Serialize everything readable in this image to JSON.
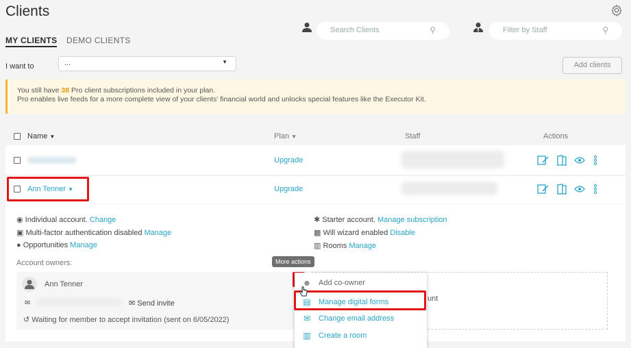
{
  "page": {
    "title": "Clients"
  },
  "tabs": [
    {
      "label": "MY CLIENTS"
    },
    {
      "label": "DEMO CLIENTS"
    }
  ],
  "search": {
    "placeholder": "Search Clients"
  },
  "staff_filter": {
    "placeholder": "Filter by Staff"
  },
  "i_want_to": {
    "label": "I want to",
    "value": "..."
  },
  "add_clients": {
    "label": "Add clients"
  },
  "banner": {
    "pre": "You still have ",
    "count": "38",
    "post": " Pro client subscriptions included in your plan.",
    "line2": "Pro enables live feeds for a more complete view of your clients' financial world and unlocks special features like the Executor Kit."
  },
  "table": {
    "headers": {
      "name": "Name",
      "plan": "Plan",
      "staff": "Staff",
      "actions": "Actions"
    },
    "rows": [
      {
        "name": "",
        "plan": "Upgrade"
      },
      {
        "name": "Ann Tenner",
        "plan": "Upgrade"
      }
    ]
  },
  "details": {
    "individual": "Individual account.",
    "individual_link": "Change",
    "mfa": "Multi-factor authentication disabled",
    "mfa_link": "Manage",
    "opportunities": "Opportunities",
    "opportunities_link": "Manage",
    "starter": "Starter account.",
    "starter_link": "Manage subscription",
    "wizard": "Will wizard enabled",
    "wizard_link": "Disable",
    "rooms": "Rooms",
    "rooms_link": "Manage",
    "owners_label": "Account owners:"
  },
  "owner": {
    "name": "Ann Tenner",
    "send_invite": "Send invite",
    "waiting": "Waiting for member to accept invitation (sent on 6/05/2022)"
  },
  "dash_text": "unt",
  "tooltip": "More actions",
  "menu": [
    {
      "label": "Add co-owner",
      "icon": "add-person-icon"
    },
    {
      "label": "Manage digital forms",
      "icon": "clipboard-icon"
    },
    {
      "label": "Change email address",
      "icon": "envelope-icon"
    },
    {
      "label": "Create a room",
      "icon": "room-icon"
    }
  ],
  "colors": {
    "accent": "#27a3c7",
    "highlight": "#e01616",
    "banner_border": "#f2b630",
    "count": "#e99b00"
  }
}
